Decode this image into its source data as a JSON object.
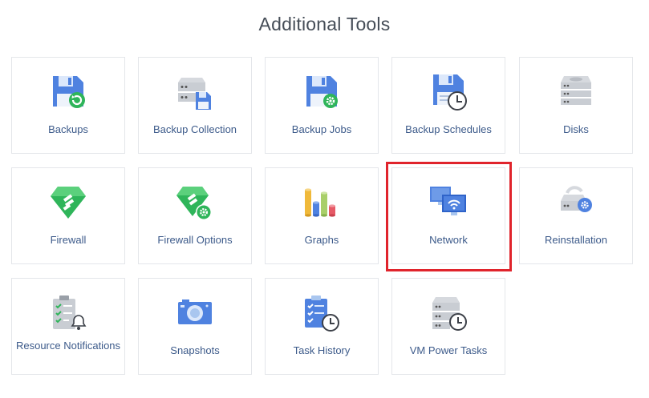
{
  "page": {
    "title": "Additional Tools"
  },
  "tools": [
    {
      "label": "Backups",
      "icon": "backup-icon"
    },
    {
      "label": "Backup Collection",
      "icon": "backup-collection-icon"
    },
    {
      "label": "Backup Jobs",
      "icon": "backup-jobs-icon"
    },
    {
      "label": "Backup Schedules",
      "icon": "backup-schedules-icon"
    },
    {
      "label": "Disks",
      "icon": "disks-icon"
    },
    {
      "label": "Firewall",
      "icon": "firewall-icon"
    },
    {
      "label": "Firewall Options",
      "icon": "firewall-options-icon"
    },
    {
      "label": "Graphs",
      "icon": "graphs-icon"
    },
    {
      "label": "Network",
      "icon": "network-icon",
      "selected": true
    },
    {
      "label": "Reinstallation",
      "icon": "reinstallation-icon"
    },
    {
      "label": "Resource Notifications",
      "icon": "resource-notifications-icon"
    },
    {
      "label": "Snapshots",
      "icon": "snapshots-icon"
    },
    {
      "label": "Task History",
      "icon": "task-history-icon"
    },
    {
      "label": "VM Power Tasks",
      "icon": "vm-power-tasks-icon"
    }
  ],
  "colors": {
    "primary_blue": "#4f82e0",
    "light_blue": "#a9c6ef",
    "green": "#2fb55a",
    "gray": "#c9cdd3",
    "selection_border": "#e0242c",
    "label_text": "#3c5a8a"
  }
}
